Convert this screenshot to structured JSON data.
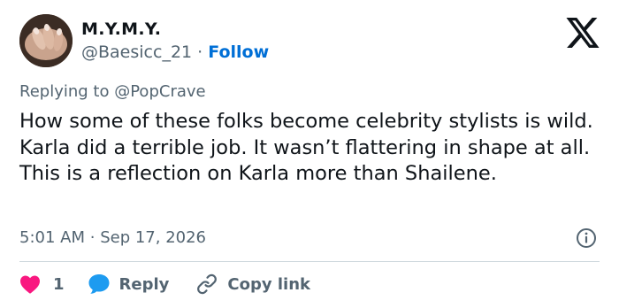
{
  "user": {
    "display_name": "M.Y.M.Y.",
    "handle": "@Baesicc_21",
    "separator": "·",
    "follow_label": "Follow"
  },
  "reply_context": {
    "prefix": "Replying to",
    "mention": "@PopCrave"
  },
  "tweet": {
    "text": "How some of these folks become celebrity stylists is wild. Karla did a terrible job. It wasn’t flattering in shape at all. This is a reflection on Karla more than Shailene.",
    "time": "5:01 AM",
    "separator": "·",
    "date": "Sep 17, 2026"
  },
  "actions": {
    "like_count": "1",
    "reply_label": "Reply",
    "copy_link_label": "Copy link"
  },
  "icons": {
    "logo": "x-logo-icon",
    "info": "info-icon",
    "like": "heart-icon",
    "reply": "speech-bubble-icon",
    "copy": "link-icon"
  },
  "colors": {
    "text": "#0f1419",
    "secondary": "#536471",
    "follow": "#006fd6",
    "heart": "#f91880",
    "reply_bubble": "#1d9bf0",
    "divider": "#cfd9de"
  }
}
